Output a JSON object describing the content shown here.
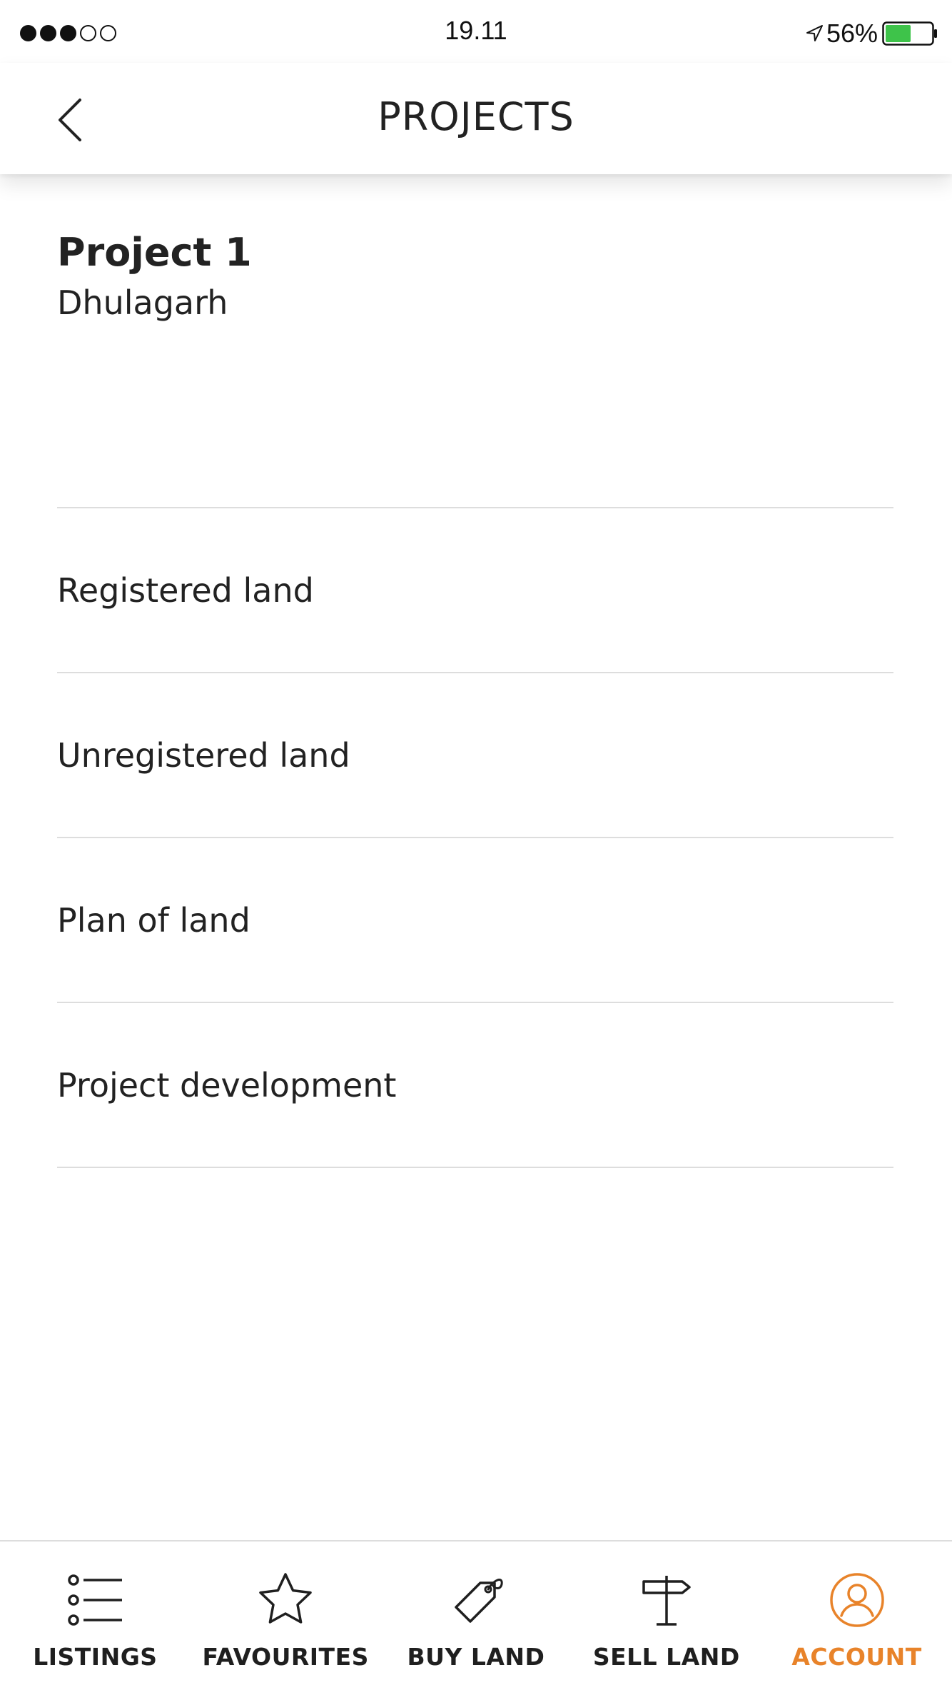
{
  "status_bar": {
    "signal_filled": 3,
    "signal_empty": 2,
    "time": "19.11",
    "battery_percent": "56%",
    "battery_level": 0.56,
    "battery_color": "#3ec34a"
  },
  "header": {
    "back_icon": "chevron-left-icon",
    "title": "PROJECTS"
  },
  "project": {
    "title": "Project 1",
    "location": "Dhulagarh"
  },
  "menu": {
    "items": [
      {
        "label": "Registered land"
      },
      {
        "label": "Unregistered land"
      },
      {
        "label": "Plan of land"
      },
      {
        "label": "Project development"
      }
    ]
  },
  "tab_bar": {
    "active_color": "#e8832a",
    "tabs": [
      {
        "label": "LISTINGS",
        "icon": "list-icon",
        "active": false
      },
      {
        "label": "FAVOURITES",
        "icon": "star-icon",
        "active": false
      },
      {
        "label": "BUY LAND",
        "icon": "price-tag-icon",
        "active": false
      },
      {
        "label": "SELL LAND",
        "icon": "signpost-icon",
        "active": false
      },
      {
        "label": "ACCOUNT",
        "icon": "user-circle-icon",
        "active": true
      }
    ]
  }
}
